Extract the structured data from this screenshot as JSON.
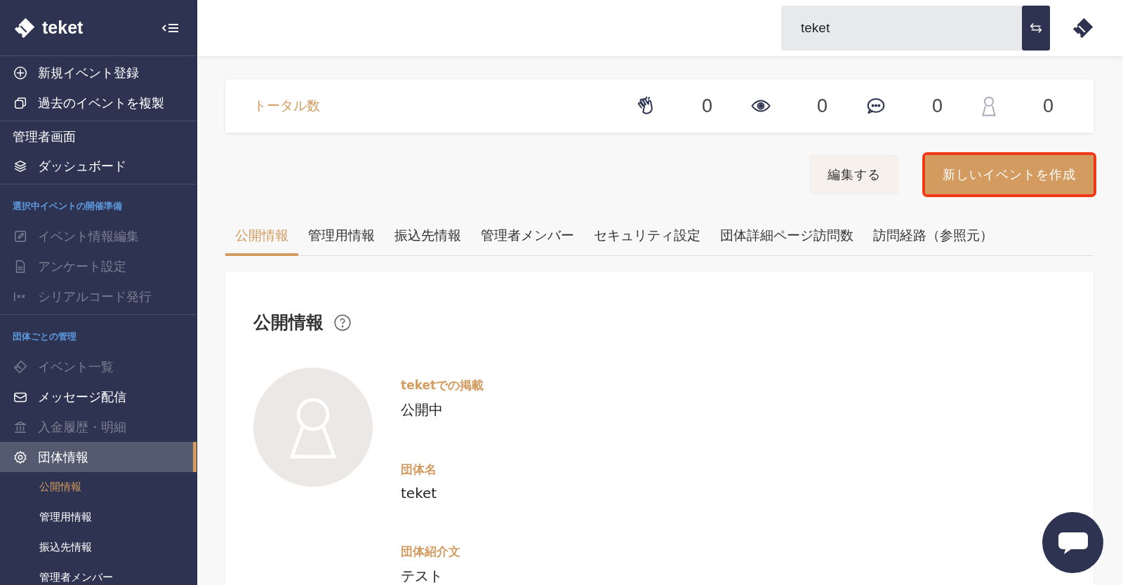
{
  "sidebar": {
    "logo": "teket",
    "sections": [
      {
        "entries": [
          {
            "kind": "item",
            "label": "新規イベント登録",
            "disabled": false,
            "selected": false
          },
          {
            "kind": "item",
            "label": "過去のイベントを複製",
            "disabled": false,
            "selected": false
          }
        ]
      },
      {
        "entries": [
          {
            "kind": "title",
            "label": "管理者画面"
          },
          {
            "kind": "item",
            "label": "ダッシュボード",
            "disabled": false,
            "selected": false
          }
        ]
      },
      {
        "entries": [
          {
            "kind": "caption",
            "label": "選択中イベントの開催準備"
          },
          {
            "kind": "item",
            "label": "イベント情報編集",
            "disabled": true,
            "selected": false
          },
          {
            "kind": "item",
            "label": "アンケート設定",
            "disabled": true,
            "selected": false
          },
          {
            "kind": "item",
            "label": "シリアルコード発行",
            "disabled": true,
            "selected": false
          }
        ]
      },
      {
        "entries": [
          {
            "kind": "caption",
            "label": "団体ごとの管理"
          },
          {
            "kind": "item",
            "label": "イベント一覧",
            "disabled": true,
            "selected": false
          },
          {
            "kind": "item",
            "label": "メッセージ配信",
            "disabled": false,
            "selected": false
          },
          {
            "kind": "item",
            "label": "入金履歴・明細",
            "disabled": true,
            "selected": false
          },
          {
            "kind": "item",
            "label": "団体情報",
            "disabled": false,
            "selected": true
          },
          {
            "kind": "sub",
            "label": "公開情報",
            "selected": true
          },
          {
            "kind": "sub",
            "label": "管理用情報",
            "selected": false
          },
          {
            "kind": "sub",
            "label": "振込先情報",
            "selected": false
          },
          {
            "kind": "sub",
            "label": "管理者メンバー",
            "selected": false
          }
        ]
      }
    ]
  },
  "header": {
    "search": {
      "value": "teket"
    }
  },
  "totals": {
    "label": "トータル数",
    "stats": [
      {
        "value": "0"
      },
      {
        "value": "0"
      },
      {
        "value": "0"
      },
      {
        "value": "0"
      }
    ]
  },
  "actions": [
    {
      "kind": "secondary",
      "label": "編集する",
      "highlighted": false
    },
    {
      "kind": "primary",
      "label": "新しいイベントを作成",
      "highlighted": true
    }
  ],
  "tabs": [
    {
      "label": "公開情報",
      "selected": true
    },
    {
      "label": "管理用情報",
      "selected": false
    },
    {
      "label": "振込先情報",
      "selected": false
    },
    {
      "label": "管理者メンバー",
      "selected": false
    },
    {
      "label": "セキュリティ設定",
      "selected": false
    },
    {
      "label": "団体詳細ページ訪問数",
      "selected": false
    },
    {
      "label": "訪問経路（参照元）",
      "selected": false
    }
  ],
  "profile": {
    "title": "公開情報",
    "fields": [
      {
        "label": "teketでの掲載",
        "value": "公開中"
      },
      {
        "label": "団体名",
        "value": "teket"
      },
      {
        "label": "団体紹介文",
        "value": "テスト"
      }
    ]
  }
}
